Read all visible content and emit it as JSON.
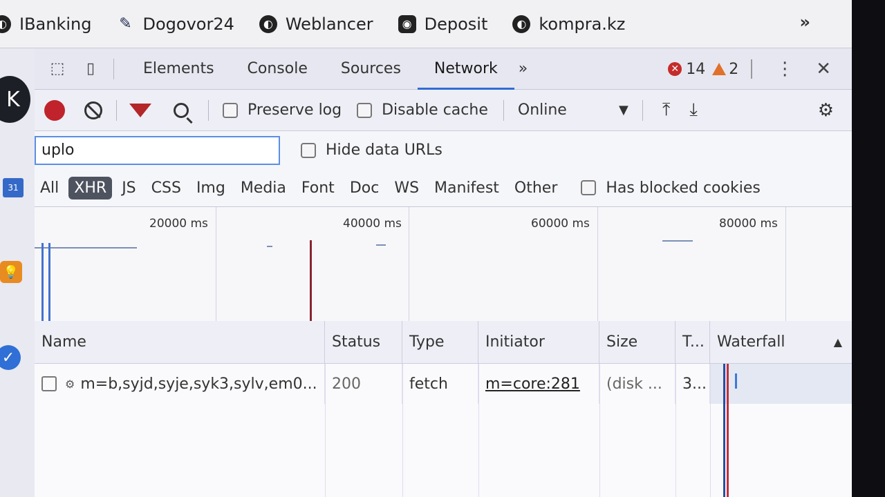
{
  "bookmarks": [
    {
      "label": "IBanking",
      "icon": "globe-icon"
    },
    {
      "label": "Dogovor24",
      "icon": "pen-icon"
    },
    {
      "label": "Weblancer",
      "icon": "globe-icon"
    },
    {
      "label": "Deposit",
      "icon": "camera-icon"
    },
    {
      "label": "kompra.kz",
      "icon": "globe-icon"
    }
  ],
  "bookmarks_more": "»",
  "page": {
    "avatar_letter": "K",
    "calendar_badge": "31"
  },
  "devtools": {
    "tabs": [
      "Elements",
      "Console",
      "Sources",
      "Network"
    ],
    "active_tab": "Network",
    "more_tabs": "»",
    "error_count": "14",
    "warning_count": "2",
    "kebab": "⋮",
    "close": "✕"
  },
  "toolbar": {
    "preserve_log": "Preserve log",
    "disable_cache": "Disable cache",
    "throttle": "Online",
    "throttle_arrow": "▼",
    "upload_icon": "⤒",
    "download_icon": "⤓",
    "gear_icon": "⚙"
  },
  "filter": {
    "value": "uplo",
    "hide_data_urls": "Hide data URLs"
  },
  "types": [
    "All",
    "XHR",
    "JS",
    "CSS",
    "Img",
    "Media",
    "Font",
    "Doc",
    "WS",
    "Manifest",
    "Other"
  ],
  "active_type": "XHR",
  "blocked_cookies": "Has blocked cookies",
  "overview": {
    "ticks": [
      "20000 ms",
      "40000 ms",
      "60000 ms",
      "80000 ms"
    ]
  },
  "table": {
    "headers": [
      "Name",
      "Status",
      "Type",
      "Initiator",
      "Size",
      "T...",
      "Waterfall"
    ],
    "sort_indicator": "▲",
    "rows": [
      {
        "name": "m=b,syjd,syje,syk3,sylv,em0...",
        "status": "200",
        "type": "fetch",
        "initiator": "m=core:281",
        "size": "(disk ...",
        "time": "3..."
      }
    ]
  }
}
